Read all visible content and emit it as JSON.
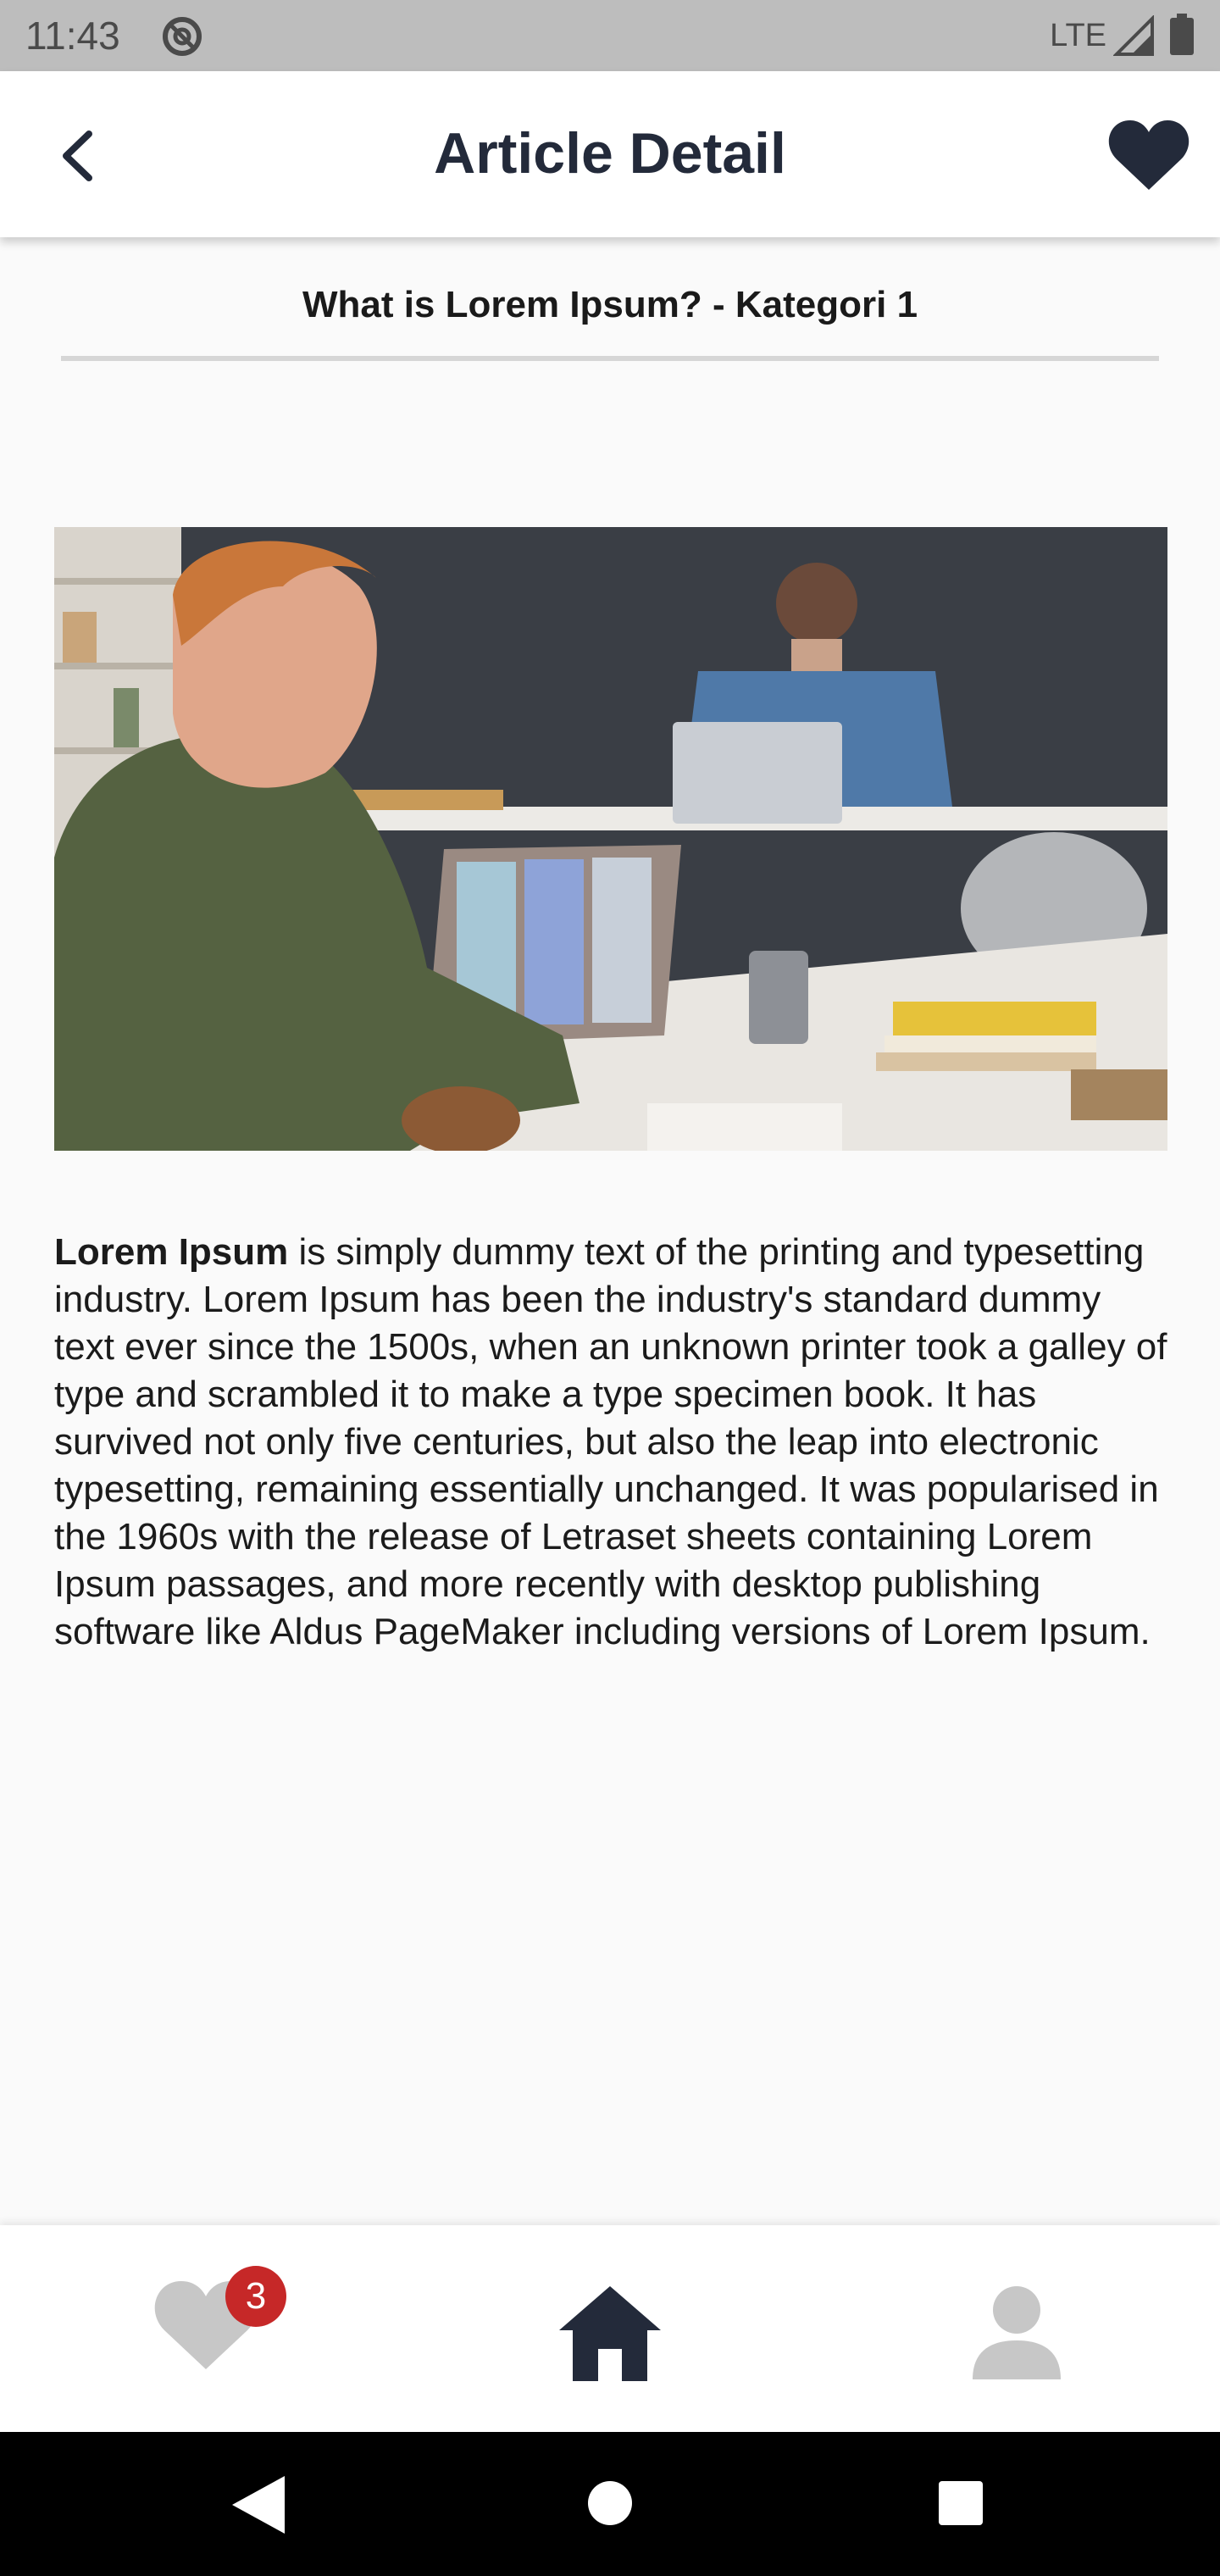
{
  "status_bar": {
    "time": "11:43",
    "network": "LTE",
    "icons": [
      "do-not-disturb-icon",
      "signal-icon",
      "battery-icon"
    ]
  },
  "app_bar": {
    "title": "Article Detail",
    "back_icon": "chevron-left-icon",
    "favorite_icon": "heart-icon"
  },
  "article": {
    "heading": "What is Lorem Ipsum? - Kategori 1",
    "body_lead": "Lorem Ipsum",
    "body_text": " is simply dummy text of the printing and typesetting industry. Lorem Ipsum has been the industry's standard dummy text ever since the 1500s, when an unknown printer took a galley of type and scrambled it to make a type specimen book. It has survived not only five centuries, but also the leap into electronic typesetting, remaining essentially unchanged. It was popularised in the 1960s with the release of Letraset sheets containing Lorem Ipsum passages, and more recently with desktop publishing software like Aldus PageMaker including versions of Lorem Ipsum."
  },
  "bottom_nav": {
    "favorites_badge": "3",
    "items": [
      "heart-icon",
      "home-icon",
      "person-icon"
    ]
  },
  "colors": {
    "accent": "#232a3a",
    "badge": "#c62828",
    "background": "#fafafa"
  }
}
